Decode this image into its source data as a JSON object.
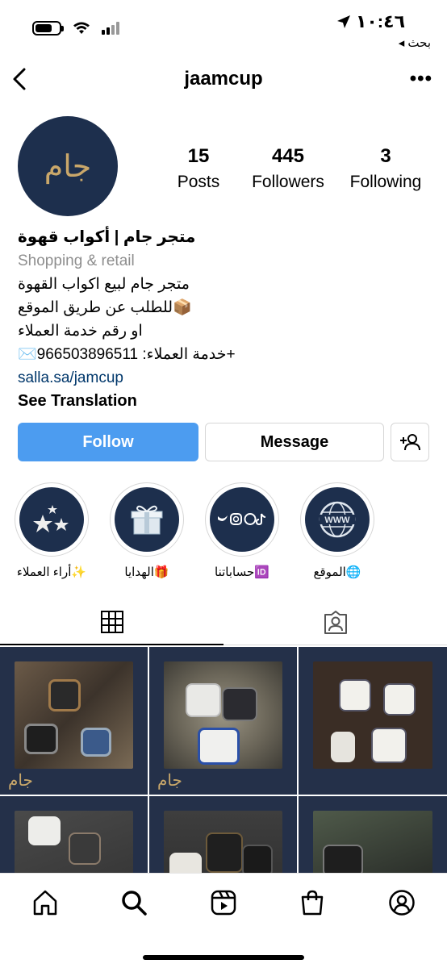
{
  "status_bar": {
    "time": "١٠:٤٦",
    "back_app": "◂ بحث"
  },
  "header": {
    "username": "jaamcup",
    "more": "•••"
  },
  "profile": {
    "avatar_logo": "جام",
    "stats": [
      {
        "value": "15",
        "label": "Posts"
      },
      {
        "value": "445",
        "label": "Followers"
      },
      {
        "value": "3",
        "label": "Following"
      }
    ]
  },
  "bio": {
    "name": "متجر جام | أكواب قهوة",
    "category": "Shopping & retail",
    "line1": "متجر جام لبيع اكواب القهوة",
    "line2": "📦للطلب عن طريق الموقع",
    "line3": "او رقم خدمة العملاء",
    "line4": "✉️خدمة العملاء: 966503896511+",
    "link": "salla.sa/jamcup",
    "see_translation": "See Translation"
  },
  "buttons": {
    "follow": "Follow",
    "message": "Message"
  },
  "highlights": [
    {
      "label": "أراء العملاء✨",
      "icon": "stars-icon"
    },
    {
      "label": "الهدايا🎁",
      "icon": "gift-icon"
    },
    {
      "label": "حساباتنا🆔",
      "icon": "social-icons"
    },
    {
      "label": "الموقع🌐",
      "icon": "www-globe-icon"
    }
  ],
  "grid_watermark": "جام",
  "colors": {
    "follow_blue": "#4c9cf0",
    "brand_navy": "#1d2f4d",
    "brand_gold": "#c9a76a",
    "link": "#00376b"
  }
}
